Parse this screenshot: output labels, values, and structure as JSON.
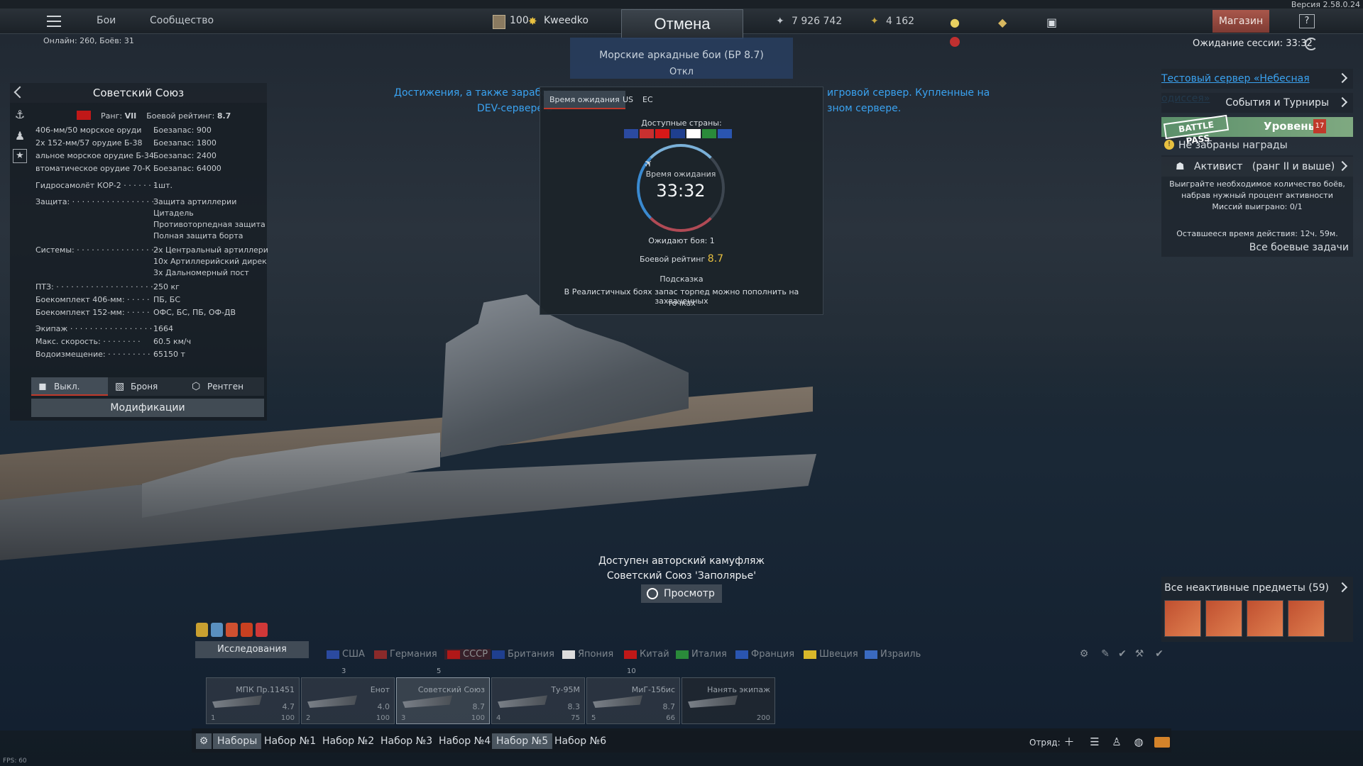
{
  "topbar": {
    "version": "Версия 2.58.0.24",
    "nav": [
      "Бои",
      "Сообщество"
    ],
    "online": "Онлайн: 260, Боёв: 31",
    "player_level": "100",
    "player_name": "Kweedko",
    "cancel_label": "Отмена",
    "silver_lions": "7 926 742",
    "golden_eagles": "4 162",
    "shop_label": "Магазин",
    "help_label": "?"
  },
  "session": {
    "label": "Ожидание сессии: 33:32"
  },
  "mode": {
    "name": "Морские аркадные бои (БР 8.7)",
    "off_label": "Откл"
  },
  "notice": {
    "line1_left": "Достижения, а также заработан",
    "line1_right": "игровой сервер. Купленные на",
    "line2_left": "DEV-сервере З",
    "line2_right": "зном сервере."
  },
  "vehicle": {
    "title": "Советский Союз",
    "rank_label": "Ранг:",
    "rank_value": "VII",
    "br_label": "Боевой рейтинг:",
    "br_value": "8.7",
    "weapons": [
      {
        "name": "406-мм/50 морское оруди",
        "value": "Боезапас:  900"
      },
      {
        "name": "2х  152-мм/57 орудие Б-38",
        "value": "Боезапас:  1800"
      },
      {
        "name": "альное морское орудие Б-34",
        "value": "Боезапас:  2400"
      },
      {
        "name": "втоматическое орудие 70-К",
        "value": "Боезапас:  64000"
      }
    ],
    "stats": [
      {
        "label": "Гидросамолёт КОР-2 · · · · · · ·",
        "value": "1шт."
      },
      {
        "label": "Защита: · · · · · · · · · · · · · · · · ·",
        "value": "Защита артиллерии"
      },
      {
        "label": "",
        "value": "Цитадель"
      },
      {
        "label": "",
        "value": "Противоторпедная защита"
      },
      {
        "label": "",
        "value": "Полная защита борта"
      },
      {
        "label": "Системы: · · · · · · · · · · · · · · · · ·",
        "value": "2х Центральный артиллери"
      },
      {
        "label": "",
        "value": "10х Артиллерийский дирек"
      },
      {
        "label": "",
        "value": "3х Дальномерный пост"
      },
      {
        "label": "ПТЗ: · · · · · · · · · · · · · · · · · · · ·",
        "value": "250 кг"
      },
      {
        "label": "Боекомплект 406-мм: · · · · ·",
        "value": "ПБ, БС"
      },
      {
        "label": "Боекомплект 152-мм: · · · · ·",
        "value": "ОФС, БС, ПБ, ОФ-ДВ"
      },
      {
        "label": "Экипаж · · · · · · · · · · · · · · · · · ·",
        "value": "1664"
      },
      {
        "label": "Макс. скорость: · · · · · · · ·",
        "value": "60.5 км/ч"
      },
      {
        "label": "Водоизмещение: · · · · · · · · ·",
        "value": "65150 т"
      }
    ],
    "toggle_off": "Выкл.",
    "toggle_armor": "Броня",
    "toggle_xray": "Рентген",
    "mods_label": "Модификации"
  },
  "queue": {
    "tabs": [
      "Время ожидания",
      "US",
      "EC"
    ],
    "countries_label": "Доступные страны:",
    "flags": [
      "#2b4aa0",
      "#c83030",
      "#d81818",
      "#1f3f8f",
      "#ffffff",
      "#2a8a3a",
      "#2a55b0"
    ],
    "timer_label": "Время ожидания",
    "timer": "33:32",
    "waiting": "Ожидают боя: 1",
    "br_label": "Боевой рейтинг",
    "br_value": "8.7",
    "hint_title": "Подсказка",
    "hint_line1": "В Реалистичных боях запас торпед можно пополнить на захваченных",
    "hint_line2": "точках"
  },
  "right": {
    "test_server": "Тестовый сервер «Небесная одиссея»",
    "events": "События и Турниры",
    "bp_logo": "BATTLE PASS",
    "bp_level": "Уровень",
    "bp_num": "17",
    "bp_rewards": "Не забраны награды",
    "activist": "Активист",
    "activist_rank": "(ранг II и выше)",
    "act_desc1": "Выиграйте необходимое количество боёв,",
    "act_desc2": "набрав нужный процент активности",
    "missions": "Миссий выиграно: 0/1",
    "remaining": "Оставшееся время действия: 12ч. 59м.",
    "all_tasks": "Все боевые задачи",
    "inactive": "Все неактивные предметы (59)"
  },
  "camo": {
    "line1": "Доступен авторский камуфляж",
    "line2": "Советский Союз 'Заполярье'",
    "view": "Просмотр"
  },
  "research": {
    "label": "Исследования"
  },
  "nations": [
    "США",
    "Германия",
    "СССР",
    "Британия",
    "Япония",
    "Китай",
    "Италия",
    "Франция",
    "Швеция",
    "Израиль"
  ],
  "nation_colors": [
    "#2b4aa0",
    "#8a2a2a",
    "#b01818",
    "#1f3f8f",
    "#dcdcdc",
    "#c01818",
    "#2a8a3a",
    "#2a55b0",
    "#d9b82a",
    "#3a6ac0"
  ],
  "slots": [
    {
      "rank": "",
      "name": "МПК Пр.11451",
      "br": "4.7",
      "num": "1",
      "cost": "100"
    },
    {
      "rank": "3",
      "name": "Енот",
      "br": "4.0",
      "num": "2",
      "cost": "100"
    },
    {
      "rank": "5",
      "name": "Советский Союз",
      "br": "8.7",
      "num": "3",
      "cost": "100"
    },
    {
      "rank": "",
      "name": "Ту-95М",
      "br": "8.3",
      "num": "4",
      "cost": "75"
    },
    {
      "rank": "10",
      "name": "МиГ-15бис",
      "br": "8.7",
      "num": "5",
      "cost": "66"
    },
    {
      "rank": "",
      "name": "Нанять экипаж",
      "br": "",
      "num": "",
      "cost": "200"
    }
  ],
  "presets": [
    "Наборы",
    "Набор №1",
    "Набор №2",
    "Набор №3",
    "Набор №4",
    "Набор №5",
    "Набор №6"
  ],
  "squad_label": "Отряд:",
  "fps": "FPS: 60"
}
